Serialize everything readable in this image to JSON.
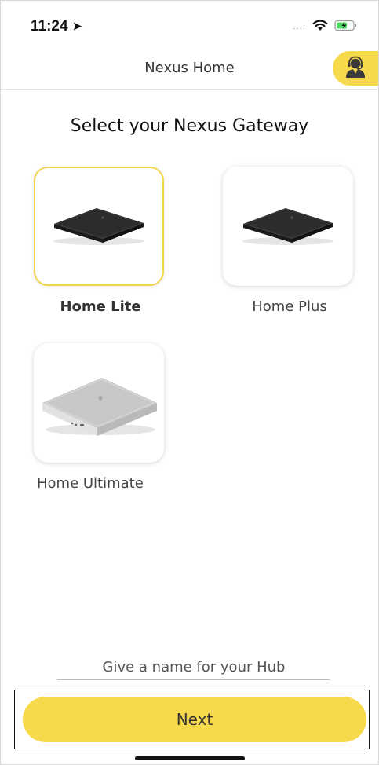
{
  "status_bar": {
    "time": "11:24",
    "location_icon": "location-arrow-icon",
    "signal": "....",
    "wifi_icon": "wifi-icon",
    "battery_icon": "battery-charging-icon",
    "battery_color": "#4cd964"
  },
  "nav": {
    "title": "Nexus Home",
    "support_icon": "customer-support-icon"
  },
  "heading": "Select your Nexus Gateway",
  "devices": [
    {
      "label": "Home Lite",
      "selected": true
    },
    {
      "label": "Home Plus",
      "selected": false
    },
    {
      "label": "Home Ultimate",
      "selected": false
    }
  ],
  "hub_name": {
    "placeholder": "Give a name for your Hub",
    "value": ""
  },
  "next_button": {
    "label": "Next"
  },
  "colors": {
    "accent": "#f7d94c",
    "selected_border": "#f2d64b"
  }
}
